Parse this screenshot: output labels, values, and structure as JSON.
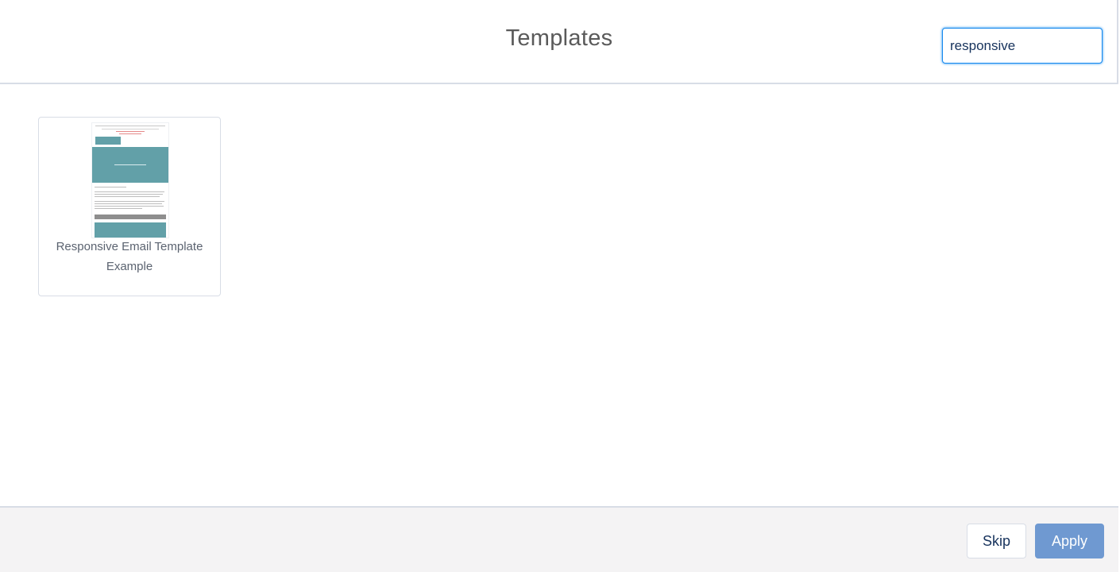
{
  "header": {
    "title": "Templates",
    "search_value": "responsive"
  },
  "templates": [
    {
      "name": "Responsive Email Template Example"
    }
  ],
  "footer": {
    "skip_label": "Skip",
    "apply_label": "Apply"
  },
  "colors": {
    "accent": "#1589ee",
    "apply_button": "#6f99d1",
    "thumbnail_teal": "#62a0a8",
    "footer_bg": "#f4f3f4"
  }
}
